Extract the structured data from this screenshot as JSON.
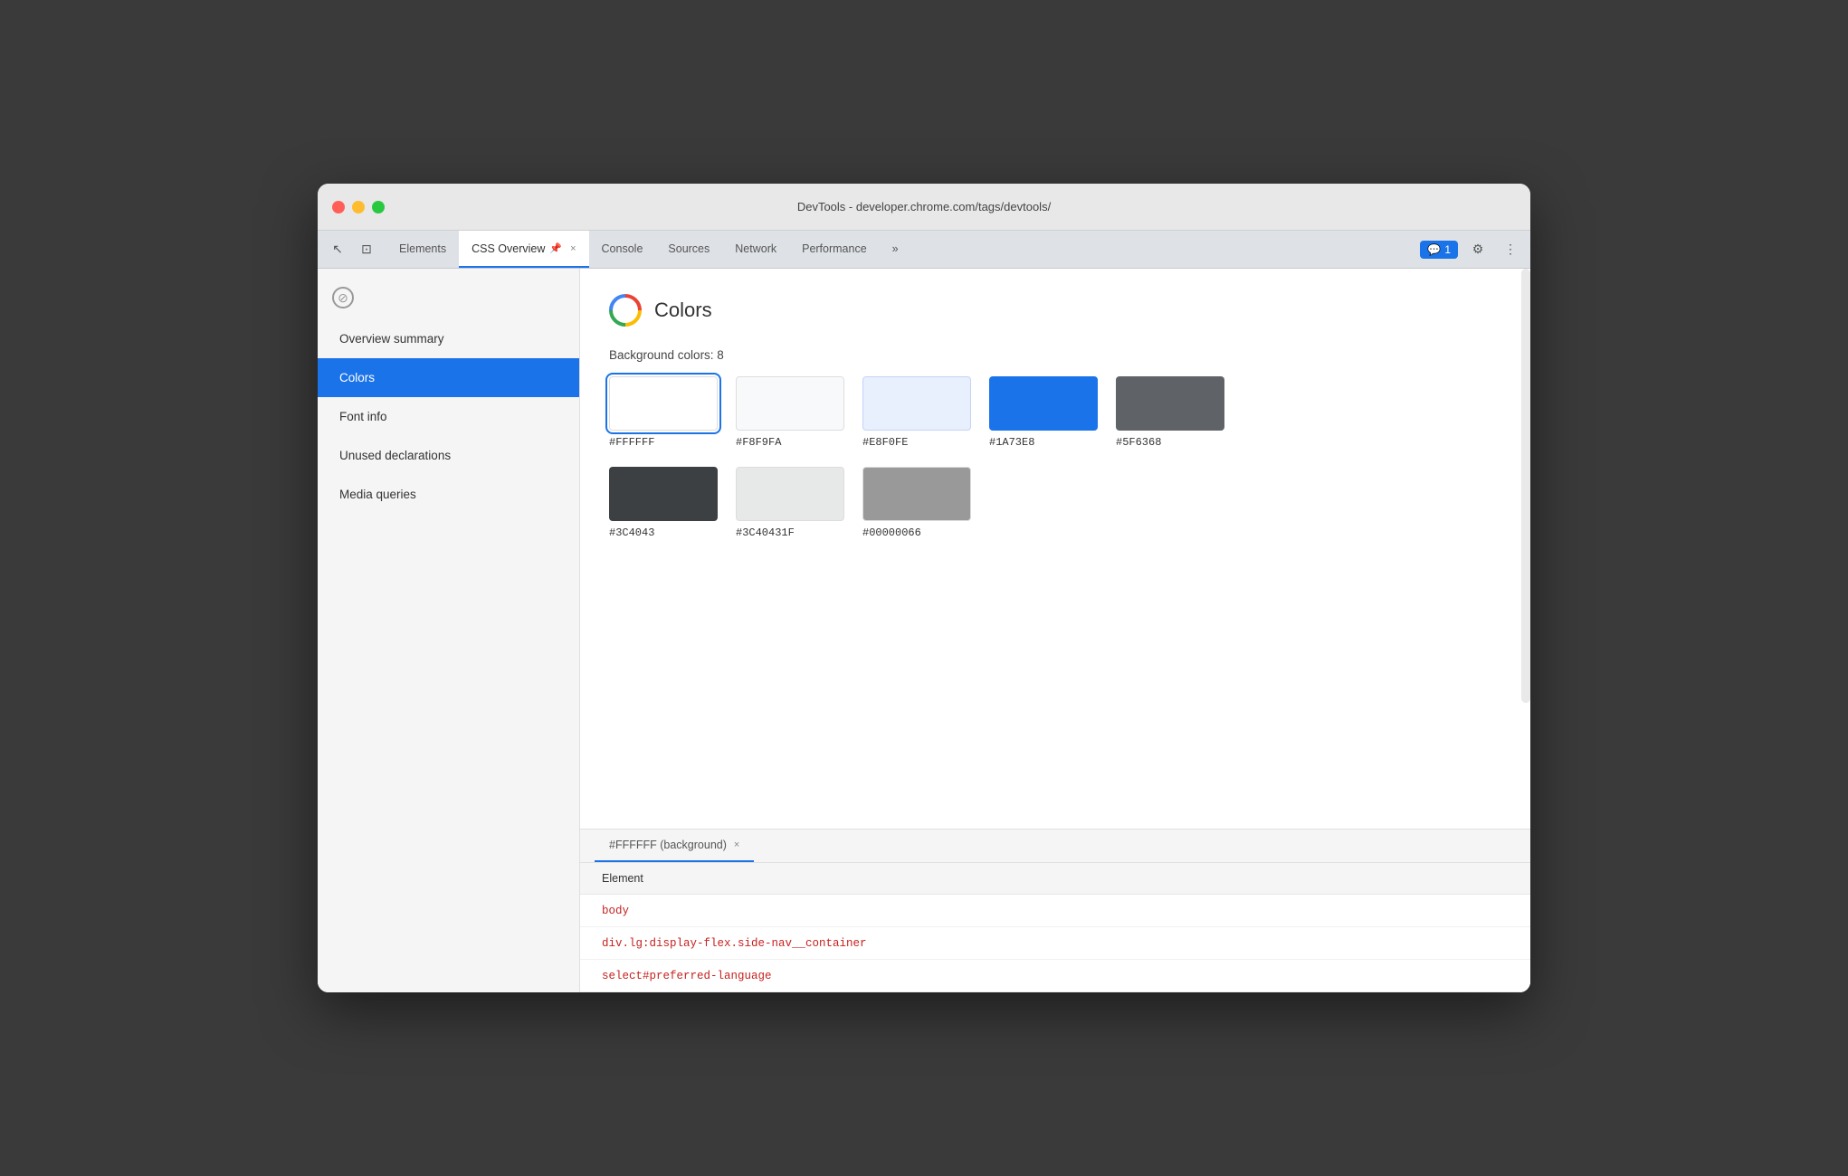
{
  "window": {
    "title": "DevTools - developer.chrome.com/tags/devtools/"
  },
  "tabs": [
    {
      "id": "elements",
      "label": "Elements",
      "active": false,
      "closeable": false
    },
    {
      "id": "css-overview",
      "label": "CSS Overview",
      "active": true,
      "closeable": true,
      "has_icon": true
    },
    {
      "id": "console",
      "label": "Console",
      "active": false,
      "closeable": false
    },
    {
      "id": "sources",
      "label": "Sources",
      "active": false,
      "closeable": false
    },
    {
      "id": "network",
      "label": "Network",
      "active": false,
      "closeable": false
    },
    {
      "id": "performance",
      "label": "Performance",
      "active": false,
      "closeable": false
    }
  ],
  "more_tabs_label": "»",
  "chat_badge": "1",
  "sidebar": {
    "items": [
      {
        "id": "overview-summary",
        "label": "Overview summary",
        "active": false
      },
      {
        "id": "colors",
        "label": "Colors",
        "active": true
      },
      {
        "id": "font-info",
        "label": "Font info",
        "active": false
      },
      {
        "id": "unused-declarations",
        "label": "Unused declarations",
        "active": false
      },
      {
        "id": "media-queries",
        "label": "Media queries",
        "active": false
      }
    ]
  },
  "colors_section": {
    "title": "Colors",
    "bg_colors_label": "Background colors: 8",
    "swatches": [
      {
        "id": "ffffff",
        "color": "#FFFFFF",
        "label": "#FFFFFF",
        "selected": true,
        "border": true
      },
      {
        "id": "f8f9fa",
        "color": "#F8F9FA",
        "label": "#F8F9FA",
        "selected": false,
        "border": true
      },
      {
        "id": "e8f0fe",
        "color": "#E8F0FE",
        "label": "#E8F0FE",
        "selected": false,
        "border": false
      },
      {
        "id": "1a73e8",
        "color": "#1A73E8",
        "label": "#1A73E8",
        "selected": false,
        "border": false
      },
      {
        "id": "5f6368",
        "color": "#5F6368",
        "label": "#5F6368",
        "selected": false,
        "border": false
      },
      {
        "id": "3c4043",
        "color": "#3C4043",
        "label": "#3C4043",
        "selected": false,
        "border": false
      },
      {
        "id": "3c40431f",
        "color": "#3C40431F",
        "label": "#3C40431F",
        "selected": false,
        "border": true
      },
      {
        "id": "00000066",
        "color": "#00000066",
        "label": "#00000066",
        "selected": false,
        "border": true
      }
    ]
  },
  "bottom_panel": {
    "tab_label": "#FFFFFF (background)",
    "close_label": "×",
    "element_header": "Element",
    "elements": [
      {
        "selector": "body",
        "id": "body-row"
      },
      {
        "selector": "div.lg:display-flex.side-nav__container",
        "id": "div-row"
      },
      {
        "selector": "select#preferred-language",
        "id": "select-row"
      }
    ]
  },
  "icons": {
    "cursor": "↖",
    "layers": "⊡",
    "no_entry": "⊘",
    "gear": "⚙",
    "menu": "⋮",
    "chat": "💬"
  }
}
